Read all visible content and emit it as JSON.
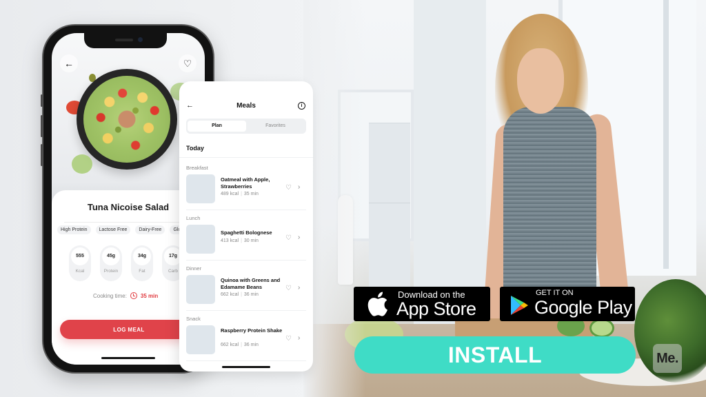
{
  "recipe_screen": {
    "title": "Tuna Nicoise Salad",
    "back_icon": "arrow-left-icon",
    "favorite_icon": "heart-icon",
    "tags": [
      "High Protein",
      "Lactose Free",
      "Dairy-Free",
      "Glut"
    ],
    "macros": [
      {
        "value": "555",
        "label": "Kcal"
      },
      {
        "value": "45g",
        "label": "Protein"
      },
      {
        "value": "34g",
        "label": "Fat"
      },
      {
        "value": "17g",
        "label": "Carb"
      }
    ],
    "cooking_time_label": "Cooking time:",
    "cooking_time_value": "35 min",
    "log_button": "LOG MEAL"
  },
  "meals_screen": {
    "title": "Meals",
    "back_icon": "arrow-left-icon",
    "info_icon": "info-icon",
    "info_glyph": "i",
    "tabs": [
      {
        "label": "Plan",
        "active": true
      },
      {
        "label": "Favorites",
        "active": false
      }
    ],
    "section_title": "Today",
    "items": [
      {
        "category": "Breakfast",
        "name": "Oatmeal with Apple, Strawberries",
        "kcal": "489 kcal",
        "time": "35 min"
      },
      {
        "category": "Lunch",
        "name": "Spaghetti Bolognese",
        "kcal": "413 kcal",
        "time": "30 min"
      },
      {
        "category": "Dinner",
        "name": "Quinoa with Greens and Edamame Beans",
        "kcal": "662 kcal",
        "time": "36 min"
      },
      {
        "category": "Snack",
        "name": "Raspberry Protein Shake",
        "kcal": "662 kcal",
        "time": "36 min"
      }
    ]
  },
  "store_badges": {
    "apple": {
      "small": "Download on the",
      "big": "App Store"
    },
    "google": {
      "small": "GET IT ON",
      "big": "Google Play"
    }
  },
  "install_button": "INSTALL",
  "brand_logo": "Me.",
  "glyphs": {
    "back": "←",
    "heart": "♡",
    "chevron": "›",
    "sep": "|"
  },
  "colors": {
    "accent_red": "#e0434a",
    "install_teal": "#3fdcc6",
    "badge_black": "#000000"
  }
}
